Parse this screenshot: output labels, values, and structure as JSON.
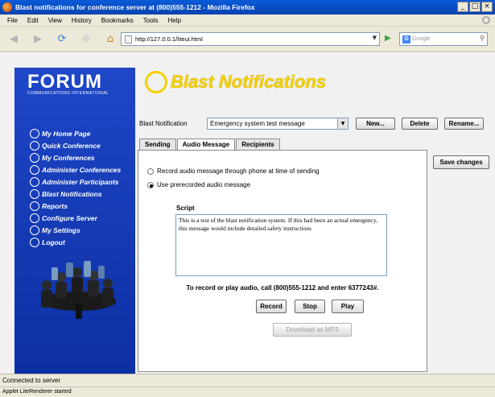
{
  "window": {
    "title": "Blast notifications for conference server at (800)555-1212 - Mozilla Firefox",
    "controls": [
      "_",
      "□",
      "×"
    ]
  },
  "menu": [
    "File",
    "Edit",
    "View",
    "History",
    "Bookmarks",
    "Tools",
    "Help"
  ],
  "browser": {
    "url": "http://127.0.0.1/liteui.html",
    "search_placeholder": "Google"
  },
  "brand": {
    "logo": "FORUM",
    "tagline": "COMMUNICATIONS INTERNATIONAL",
    "header_title": "Blast Notifications",
    "accent": "#f5d000",
    "sidebar_color": "#1e47c7"
  },
  "sidebar": {
    "items": [
      "My Home Page",
      "Quick Conference",
      "My Conferences",
      "Administer Conferences",
      "Administer Participants",
      "Blast Notifications",
      "Reports",
      "Configure Server",
      "My Settings",
      "Logout"
    ]
  },
  "blast": {
    "label": "Blast Notification",
    "selected": "Emergency system test message",
    "new_btn": "New...",
    "delete_btn": "Delete",
    "rename_btn": "Rename..."
  },
  "tabs": [
    "Sending",
    "Audio Message",
    "Recipients"
  ],
  "save_btn": "Save changes",
  "audio": {
    "option_phone": "Record audio message through phone at time of sending",
    "option_prerecorded": "Use prerecorded audio message",
    "selected_option": "prerecorded",
    "script_label": "Script",
    "script_text": "This is a test of the blast notification system.  If this had been an actual emergency, this message would include detailed safety instructions",
    "info": "To record or play audio, call (800)555-1212 and enter 6377243#.",
    "record_btn": "Record",
    "stop_btn": "Stop",
    "play_btn": "Play",
    "download_btn": "Download as MP3"
  },
  "status": {
    "connected": "Connected to server",
    "applet": "Applet LiteRenderer started"
  }
}
